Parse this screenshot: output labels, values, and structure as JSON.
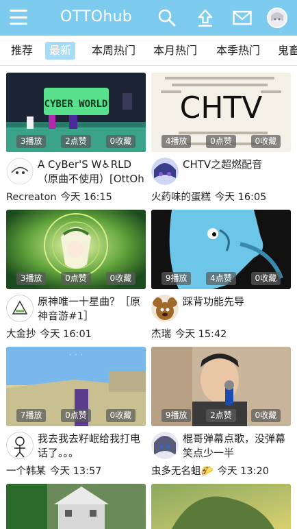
{
  "app": {
    "title": "OTTOhub"
  },
  "icons": {
    "menu": "menu-icon",
    "search": "search-icon",
    "upload": "upload-icon",
    "mail": "mail-icon",
    "avatar": "user-avatar"
  },
  "colors": {
    "appbar": "#7ecbf0",
    "tab_active": "#a8dcf4",
    "stat_overlay": "#5a5a5a"
  },
  "tabs": [
    {
      "label": "推荐",
      "active": false
    },
    {
      "label": "最新",
      "active": true
    },
    {
      "label": "本周热门",
      "active": false
    },
    {
      "label": "本月热门",
      "active": false
    },
    {
      "label": "本季热门",
      "active": false
    },
    {
      "label": "鬼畜",
      "active": false
    }
  ],
  "videos": [
    {
      "title": "A CyBer'S W♿RLD（原曲不使用）[OttOh",
      "thumb_text": "CYBER WORLD",
      "plays": "3播放",
      "likes": "2点赞",
      "favs": "0收藏",
      "author": "Recreaton",
      "time": "今天 16:15"
    },
    {
      "title": "CHTV之超燃配音",
      "thumb_text": "CHTV",
      "plays": "4播放",
      "likes": "0点赞",
      "favs": "0收藏",
      "author": "火药味的蛋糕",
      "time": "今天 16:05"
    },
    {
      "title": "原神唯一十星曲？［原神音游#1］",
      "thumb_text": "",
      "plays": "3播放",
      "likes": "0点赞",
      "favs": "0收藏",
      "author": "大金抄",
      "time": "今天 16:01"
    },
    {
      "title": "踩背功能先导",
      "thumb_text": "",
      "plays": "9播放",
      "likes": "4点赞",
      "favs": "0收藏",
      "author": "杰瑞",
      "time": "今天 15:42"
    },
    {
      "title": "我去我去籽岷给我打电话了。。。",
      "thumb_text": "",
      "plays": "7播放",
      "likes": "0点赞",
      "favs": "0收藏",
      "author": "一个韩某",
      "time": "今天 13:57"
    },
    {
      "title": "棍哥弹幕点歌，没弹幕笑点少一半",
      "thumb_text": "",
      "plays": "9播放",
      "likes": "2点赞",
      "favs": "0收藏",
      "author": "虫多无名蛆🌮",
      "time": "今天 13:20"
    }
  ]
}
